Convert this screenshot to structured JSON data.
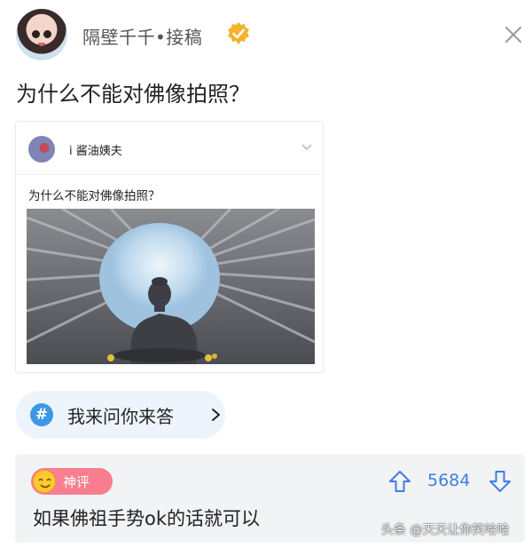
{
  "post": {
    "author": "隔壁千千•接稿",
    "title": "为什么不能对佛像拍照？"
  },
  "embedded_card": {
    "author": "i 酱油姨夫",
    "question": "为什么不能对佛像拍照？"
  },
  "topic_button": {
    "icon_glyph": "#",
    "label": "我来问你来答"
  },
  "comment": {
    "badge": "神评",
    "likes": "5684",
    "text": "如果佛祖手势ok的话就可以"
  },
  "watermark": "头条 @天天让你笑哈哈",
  "icons": [
    "verified-badge-icon",
    "close-icon",
    "chevron-down-icon",
    "hashtag-icon",
    "chevron-right-icon",
    "thumbs-up-arrow-icon",
    "thumbs-down-arrow-icon"
  ],
  "colors": {
    "accent_blue": "#3e97e6",
    "like_blue": "#3e7fdc",
    "badge_pink": "#f77d8f",
    "badge_gold": "#f4b32d"
  }
}
